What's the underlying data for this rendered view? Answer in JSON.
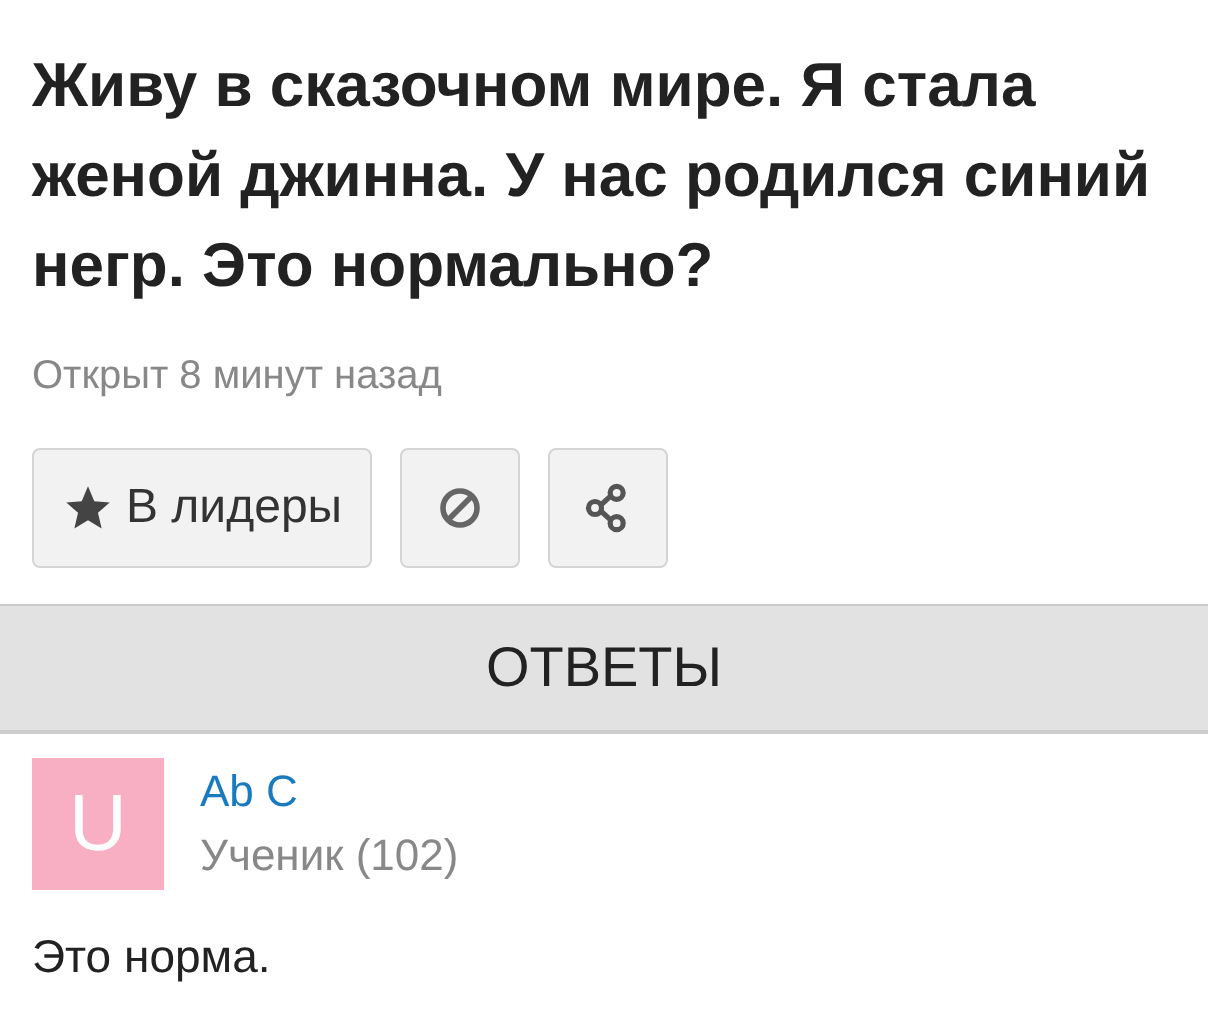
{
  "question": {
    "title": "Живу в сказочном мире. Я стала женой джинна. У нас родился синий негр. Это нормально?",
    "time": "Открыт 8 минут назад"
  },
  "actions": [
    {
      "kind": "leader",
      "label": "В лидеры"
    },
    {
      "kind": "report"
    },
    {
      "kind": "share"
    }
  ],
  "answers_header": "ОТВЕТЫ",
  "answers": [
    {
      "avatar_letter": "U",
      "color": "#f8afc3",
      "author": "Ab C",
      "rank": "Ученик (102)",
      "text": "Это норма."
    }
  ]
}
